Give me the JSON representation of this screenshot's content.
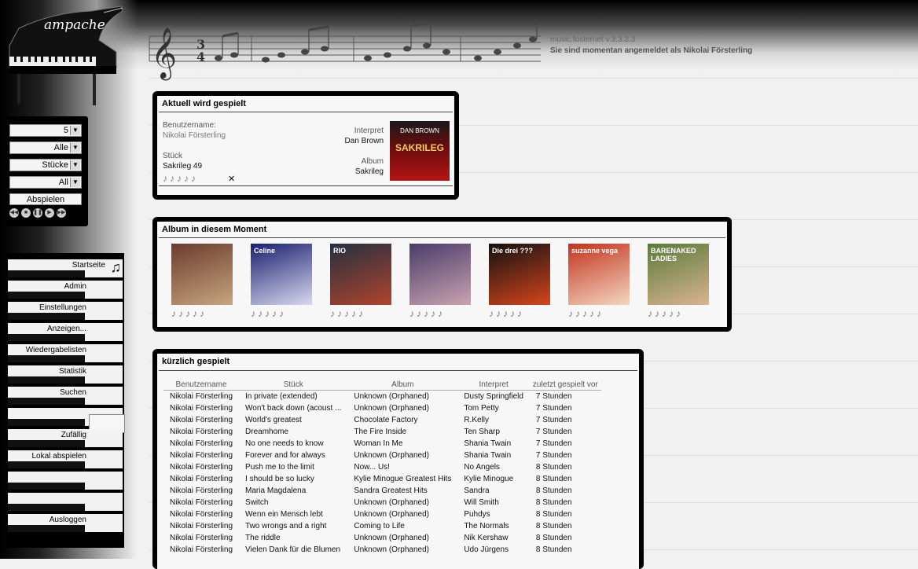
{
  "app": {
    "logo": "ampache",
    "version": "music.fosternet v.3.3.3.3",
    "login_status": "Sie sind momentan angemeldet als Nikolai Försterling"
  },
  "controls": {
    "selects": [
      "5",
      "Alle",
      "Stücke",
      "All"
    ],
    "play_label": "Abspielen",
    "playback_icons": [
      "previous-icon",
      "stop-icon",
      "pause-icon",
      "play-icon",
      "next-icon"
    ]
  },
  "menu": {
    "items": [
      "Startseite",
      "Admin",
      "Einstellungen",
      "Anzeigen...",
      "Wiedergabelisten",
      "Statistik",
      "Suchen",
      "",
      "Zufällig",
      "Lokal abspielen",
      "",
      "",
      "Ausloggen"
    ]
  },
  "now_playing": {
    "title": "Aktuell wird gespielt",
    "user_label": "Benutzername:",
    "user_value": "Nikolai Försterling",
    "song_label": "Stück",
    "song_value": "Sakrileg 49",
    "artist_label": "Interpret",
    "artist_value": "Dan Brown",
    "album_label": "Album",
    "album_value": "Sakrileg",
    "cover_art_text": "DAN BROWN",
    "cover_art_subtitle": "SAKRILEG"
  },
  "albums_now": {
    "title": "Album in diesem Moment",
    "covers": [
      {
        "color": "#6b3b2e",
        "accent": "#c7a67e"
      },
      {
        "color": "#1a1f6e",
        "accent": "#d8d8f0",
        "text": "Celine"
      },
      {
        "color": "#243040",
        "accent": "#b0442c",
        "text": "RIO"
      },
      {
        "color": "#4a3c6a",
        "accent": "#c9a3b0"
      },
      {
        "color": "#111111",
        "accent": "#d6451c",
        "text": "Die drei ???"
      },
      {
        "color": "#c2331e",
        "accent": "#f4d6c0",
        "text": "suzanne vega"
      },
      {
        "color": "#5a7a3a",
        "accent": "#d9b48f",
        "text": "BARENAKED LADIES"
      }
    ]
  },
  "recent": {
    "title": "kürzlich gespielt",
    "columns": [
      "Benutzername",
      "Stück",
      "Album",
      "Interpret",
      "zuletzt gespielt vor"
    ],
    "rows": [
      [
        "Nikolai Försterling",
        "In private (extended)",
        "Unknown (Orphaned)",
        "Dusty Springfield",
        "7 Stunden"
      ],
      [
        "Nikolai Försterling",
        "Won't back down (acoust ...",
        "Unknown (Orphaned)",
        "Tom Petty",
        "7 Stunden"
      ],
      [
        "Nikolai Försterling",
        "World's greatest",
        "Chocolate Factory",
        "R.Kelly",
        "7 Stunden"
      ],
      [
        "Nikolai Försterling",
        "Dreamhome",
        "The Fire Inside",
        "Ten Sharp",
        "7 Stunden"
      ],
      [
        "Nikolai Försterling",
        "No one needs to know",
        "Woman In Me",
        "Shania Twain",
        "7 Stunden"
      ],
      [
        "Nikolai Försterling",
        "Forever and for always",
        "Unknown (Orphaned)",
        "Shania Twain",
        "7 Stunden"
      ],
      [
        "Nikolai Försterling",
        "Push me to the limit",
        "Now... Us!",
        "No Angels",
        "8 Stunden"
      ],
      [
        "Nikolai Försterling",
        "I should be so lucky",
        "Kylie Minogue Greatest Hits",
        "Kylie Minogue",
        "8 Stunden"
      ],
      [
        "Nikolai Försterling",
        "Maria Magdalena",
        "Sandra Greatest Hits",
        "Sandra",
        "8 Stunden"
      ],
      [
        "Nikolai Försterling",
        "Switch",
        "Unknown (Orphaned)",
        "Will Smith",
        "8 Stunden"
      ],
      [
        "Nikolai Försterling",
        "Wenn ein Mensch lebt",
        "Unknown (Orphaned)",
        "Puhdys",
        "8 Stunden"
      ],
      [
        "Nikolai Försterling",
        "Two wrongs and a right",
        "Coming to Life",
        "The Normals",
        "8 Stunden"
      ],
      [
        "Nikolai Försterling",
        "The riddle",
        "Unknown (Orphaned)",
        "Nik Kershaw",
        "8 Stunden"
      ],
      [
        "Nikolai Försterling",
        "Vielen Dank für die Blumen",
        "Unknown (Orphaned)",
        "Udo Jürgens",
        "8 Stunden"
      ]
    ]
  }
}
